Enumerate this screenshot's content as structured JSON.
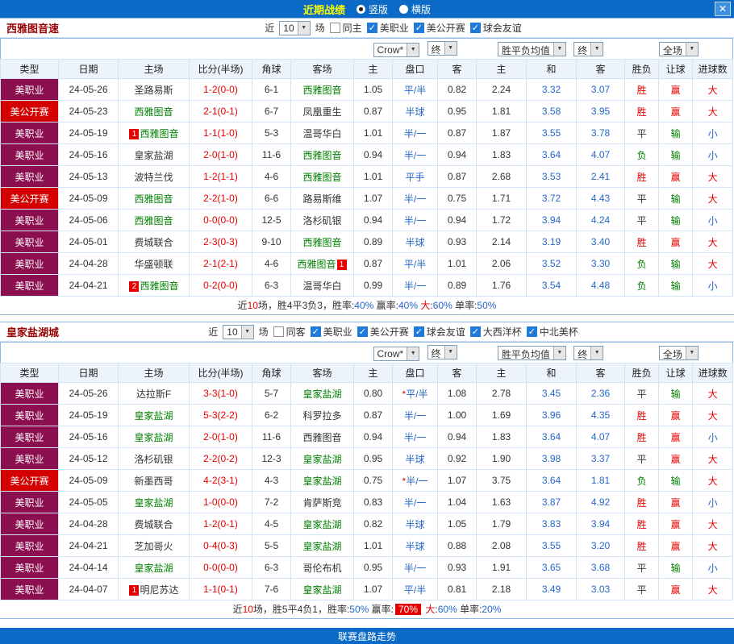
{
  "topbar": {
    "title": "近期战绩",
    "radio_vertical": "竖版",
    "radio_horizontal": "横版",
    "vertical_on": "1",
    "horizontal_on": "0",
    "close": "✕"
  },
  "colors": {
    "topbar_blue": "#0A6AC6",
    "title_yellow": "#FFFF00",
    "target_team_green": "#008000",
    "league_mls_maroon": "#8B0E4E",
    "league_usopen_red": "#D40000",
    "win_red": "#E60000",
    "lose_green": "#008000",
    "small_blue": "#2667C9"
  },
  "footer": {
    "label": "联赛盘路走势"
  },
  "sections": [
    {
      "team_title": "西雅图音速",
      "filter": {
        "near_label": "近",
        "count": "10",
        "games_label": "场",
        "same_label": "同主",
        "same_checked": "0",
        "leagues": [
          {
            "label": "美职业",
            "checked": "1"
          },
          {
            "label": "美公开赛",
            "checked": "1"
          },
          {
            "label": "球会友谊",
            "checked": "1"
          }
        ]
      },
      "selects": {
        "company": "Crow*",
        "company_final": "终",
        "avg": "胜平负均值",
        "avg_final": "终",
        "scope": "全场"
      },
      "columns": [
        "类型",
        "日期",
        "主场",
        "比分(半场)",
        "角球",
        "客场",
        "主",
        "盘口",
        "客",
        "主",
        "和",
        "客",
        "胜负",
        "让球",
        "进球数"
      ],
      "rows": [
        {
          "type": "美职业",
          "date": "24-05-26",
          "home": "圣路易斯",
          "score": "1-2(0-0)",
          "corner": "6-1",
          "away": "西雅图音",
          "away_t": "1",
          "ah": "1.05",
          "hc": "平/半",
          "aa": "0.82",
          "eh": "2.24",
          "ed": "3.32",
          "ea": "3.07",
          "res": "胜",
          "hres": "赢",
          "goal": "大"
        },
        {
          "type": "美公开赛",
          "date": "24-05-23",
          "home": "西雅图音",
          "home_t": "1",
          "score": "2-1(0-1)",
          "corner": "6-7",
          "away": "凤凰重生",
          "ah": "0.87",
          "hc": "半球",
          "aa": "0.95",
          "eh": "1.81",
          "ed": "3.58",
          "ea": "3.95",
          "res": "胜",
          "hres": "赢",
          "goal": "大"
        },
        {
          "type": "美职业",
          "date": "24-05-19",
          "home": "西雅图音",
          "home_pre": "1",
          "home_t": "1",
          "score": "1-1(1-0)",
          "corner": "5-3",
          "away": "温哥华白",
          "ah": "1.01",
          "hc": "半/一",
          "aa": "0.87",
          "eh": "1.87",
          "ed": "3.55",
          "ea": "3.78",
          "res": "平",
          "hres": "输",
          "goal": "小"
        },
        {
          "type": "美职业",
          "date": "24-05-16",
          "home": "皇家盐湖",
          "score": "2-0(1-0)",
          "corner": "11-6",
          "away": "西雅图音",
          "away_t": "1",
          "ah": "0.94",
          "hc": "半/一",
          "aa": "0.94",
          "eh": "1.83",
          "ed": "3.64",
          "ea": "4.07",
          "res": "负",
          "hres": "输",
          "goal": "小"
        },
        {
          "type": "美职业",
          "date": "24-05-13",
          "home": "波特兰伐",
          "score": "1-2(1-1)",
          "corner": "4-6",
          "away": "西雅图音",
          "away_t": "1",
          "ah": "1.01",
          "hc": "平手",
          "aa": "0.87",
          "eh": "2.68",
          "ed": "3.53",
          "ea": "2.41",
          "res": "胜",
          "hres": "赢",
          "goal": "大"
        },
        {
          "type": "美公开赛",
          "date": "24-05-09",
          "home": "西雅图音",
          "home_t": "1",
          "score": "2-2(1-0)",
          "corner": "6-6",
          "away": "路易斯维",
          "ah": "1.07",
          "hc": "半/一",
          "aa": "0.75",
          "eh": "1.71",
          "ed": "3.72",
          "ea": "4.43",
          "res": "平",
          "hres": "输",
          "goal": "大"
        },
        {
          "type": "美职业",
          "date": "24-05-06",
          "home": "西雅图音",
          "home_t": "1",
          "score": "0-0(0-0)",
          "corner": "12-5",
          "away": "洛杉矶银",
          "ah": "0.94",
          "hc": "半/一",
          "aa": "0.94",
          "eh": "1.72",
          "ed": "3.94",
          "ea": "4.24",
          "res": "平",
          "hres": "输",
          "goal": "小"
        },
        {
          "type": "美职业",
          "date": "24-05-01",
          "home": "费城联合",
          "score": "2-3(0-3)",
          "corner": "9-10",
          "away": "西雅图音",
          "away_t": "1",
          "ah": "0.89",
          "hc": "半球",
          "aa": "0.93",
          "eh": "2.14",
          "ed": "3.19",
          "ea": "3.40",
          "res": "胜",
          "hres": "赢",
          "goal": "大"
        },
        {
          "type": "美职业",
          "date": "24-04-28",
          "home": "华盛顿联",
          "score": "2-1(2-1)",
          "corner": "4-6",
          "away": "西雅图音",
          "away_t": "1",
          "away_post": "1",
          "ah": "0.87",
          "hc": "平/半",
          "aa": "1.01",
          "eh": "2.06",
          "ed": "3.52",
          "ea": "3.30",
          "res": "负",
          "hres": "输",
          "goal": "大"
        },
        {
          "type": "美职业",
          "date": "24-04-21",
          "home": "西雅图音",
          "home_pre": "2",
          "home_t": "1",
          "score": "0-2(0-0)",
          "corner": "6-3",
          "away": "温哥华白",
          "ah": "0.99",
          "hc": "半/一",
          "aa": "0.89",
          "eh": "1.76",
          "ed": "3.54",
          "ea": "4.48",
          "res": "负",
          "hres": "输",
          "goal": "小"
        }
      ],
      "summary": [
        {
          "t": "近"
        },
        {
          "t": "10",
          "c": "red"
        },
        {
          "t": "场，胜4平3负3，胜率:"
        },
        {
          "t": "40%",
          "c": "blue"
        },
        {
          "t": " 赢率:"
        },
        {
          "t": "40%",
          "c": "blue"
        },
        {
          "t": " "
        },
        {
          "t": "大",
          "c": "red"
        },
        {
          "t": ":"
        },
        {
          "t": "60%",
          "c": "blue"
        },
        {
          "t": " 单率:"
        },
        {
          "t": "50%",
          "c": "blue"
        }
      ]
    },
    {
      "team_title": "皇家盐湖城",
      "filter": {
        "near_label": "近",
        "count": "10",
        "games_label": "场",
        "same_label": "同客",
        "same_checked": "0",
        "leagues": [
          {
            "label": "美职业",
            "checked": "1"
          },
          {
            "label": "美公开赛",
            "checked": "1"
          },
          {
            "label": "球会友谊",
            "checked": "1"
          },
          {
            "label": "大西洋杯",
            "checked": "1"
          },
          {
            "label": "中北美杯",
            "checked": "1"
          }
        ]
      },
      "selects": {
        "company": "Crow*",
        "company_final": "终",
        "avg": "胜平负均值",
        "avg_final": "终",
        "scope": "全场"
      },
      "columns": [
        "类型",
        "日期",
        "主场",
        "比分(半场)",
        "角球",
        "客场",
        "主",
        "盘口",
        "客",
        "主",
        "和",
        "客",
        "胜负",
        "让球",
        "进球数"
      ],
      "rows": [
        {
          "type": "美职业",
          "date": "24-05-26",
          "home": "达拉斯F",
          "score": "3-3(1-0)",
          "corner": "5-7",
          "away": "皇家盐湖",
          "away_t": "1",
          "ah": "0.80",
          "star": "*",
          "hc": "平/半",
          "aa": "1.08",
          "eh": "2.78",
          "ed": "3.45",
          "ea": "2.36",
          "res": "平",
          "hres": "输",
          "goal": "大"
        },
        {
          "type": "美职业",
          "date": "24-05-19",
          "home": "皇家盐湖",
          "home_t": "1",
          "score": "5-3(2-2)",
          "corner": "6-2",
          "away": "科罗拉多",
          "ah": "0.87",
          "hc": "半/一",
          "aa": "1.00",
          "eh": "1.69",
          "ed": "3.96",
          "ea": "4.35",
          "res": "胜",
          "hres": "赢",
          "goal": "大"
        },
        {
          "type": "美职业",
          "date": "24-05-16",
          "home": "皇家盐湖",
          "home_t": "1",
          "score": "2-0(1-0)",
          "corner": "11-6",
          "away": "西雅图音",
          "ah": "0.94",
          "hc": "半/一",
          "aa": "0.94",
          "eh": "1.83",
          "ed": "3.64",
          "ea": "4.07",
          "res": "胜",
          "hres": "赢",
          "goal": "小"
        },
        {
          "type": "美职业",
          "date": "24-05-12",
          "home": "洛杉矶银",
          "score": "2-2(0-2)",
          "corner": "12-3",
          "away": "皇家盐湖",
          "away_t": "1",
          "ah": "0.95",
          "hc": "半球",
          "aa": "0.92",
          "eh": "1.90",
          "ed": "3.98",
          "ea": "3.37",
          "res": "平",
          "hres": "赢",
          "goal": "大"
        },
        {
          "type": "美公开赛",
          "date": "24-05-09",
          "home": "新墨西哥",
          "score": "4-2(3-1)",
          "corner": "4-3",
          "away": "皇家盐湖",
          "away_t": "1",
          "ah": "0.75",
          "star": "*",
          "hc": "半/一",
          "aa": "1.07",
          "eh": "3.75",
          "ed": "3.64",
          "ea": "1.81",
          "res": "负",
          "hres": "输",
          "goal": "大"
        },
        {
          "type": "美职业",
          "date": "24-05-05",
          "home": "皇家盐湖",
          "home_t": "1",
          "score": "1-0(0-0)",
          "corner": "7-2",
          "away": "肯萨斯竞",
          "ah": "0.83",
          "hc": "半/一",
          "aa": "1.04",
          "eh": "1.63",
          "ed": "3.87",
          "ea": "4.92",
          "res": "胜",
          "hres": "赢",
          "goal": "小"
        },
        {
          "type": "美职业",
          "date": "24-04-28",
          "home": "费城联合",
          "score": "1-2(0-1)",
          "corner": "4-5",
          "away": "皇家盐湖",
          "away_t": "1",
          "ah": "0.82",
          "hc": "半球",
          "aa": "1.05",
          "eh": "1.79",
          "ed": "3.83",
          "ea": "3.94",
          "res": "胜",
          "hres": "赢",
          "goal": "大"
        },
        {
          "type": "美职业",
          "date": "24-04-21",
          "home": "芝加哥火",
          "score": "0-4(0-3)",
          "corner": "5-5",
          "away": "皇家盐湖",
          "away_t": "1",
          "ah": "1.01",
          "hc": "半球",
          "aa": "0.88",
          "eh": "2.08",
          "ed": "3.55",
          "ea": "3.20",
          "res": "胜",
          "hres": "赢",
          "goal": "大"
        },
        {
          "type": "美职业",
          "date": "24-04-14",
          "home": "皇家盐湖",
          "home_t": "1",
          "score": "0-0(0-0)",
          "corner": "6-3",
          "away": "哥伦布机",
          "ah": "0.95",
          "hc": "半/一",
          "aa": "0.93",
          "eh": "1.91",
          "ed": "3.65",
          "ea": "3.68",
          "res": "平",
          "hres": "输",
          "goal": "小"
        },
        {
          "type": "美职业",
          "date": "24-04-07",
          "home": "明尼苏达",
          "home_pre": "1",
          "score": "1-1(0-1)",
          "corner": "7-6",
          "away": "皇家盐湖",
          "away_t": "1",
          "ah": "1.07",
          "hc": "平/半",
          "aa": "0.81",
          "eh": "2.18",
          "ed": "3.49",
          "ea": "3.03",
          "res": "平",
          "hres": "赢",
          "goal": "大"
        }
      ],
      "summary": [
        {
          "t": "近"
        },
        {
          "t": "10",
          "c": "red"
        },
        {
          "t": "场，胜5平4负1，胜率:"
        },
        {
          "t": "50%",
          "c": "blue"
        },
        {
          "t": " 赢率:"
        },
        {
          "t": "70%",
          "c": "hl"
        },
        {
          "t": " "
        },
        {
          "t": "大",
          "c": "red"
        },
        {
          "t": ":"
        },
        {
          "t": "60%",
          "c": "blue"
        },
        {
          "t": " 单率:"
        },
        {
          "t": "20%",
          "c": "blue"
        }
      ]
    }
  ]
}
